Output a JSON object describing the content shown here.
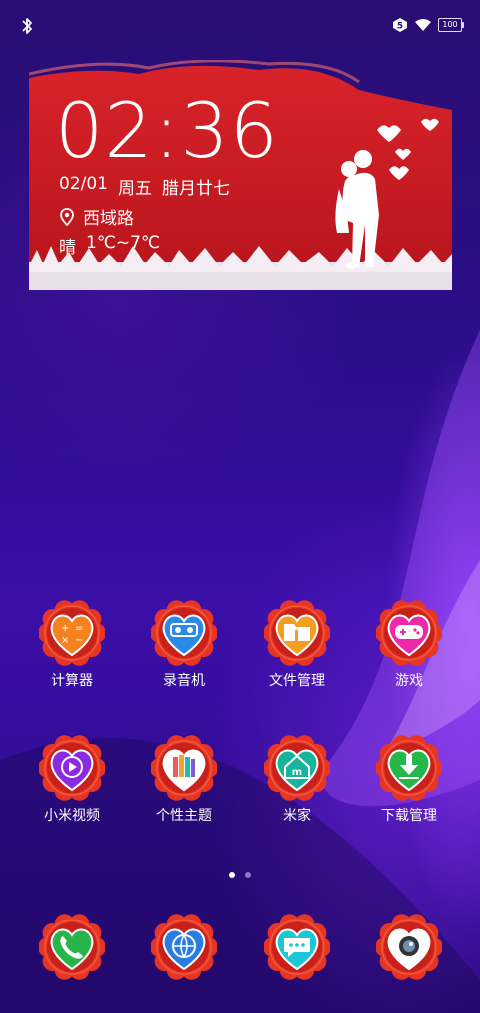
{
  "status_bar": {
    "sim_badge": "5",
    "battery": "100"
  },
  "widget": {
    "time": "02:36",
    "date": "02/01",
    "weekday": "周五",
    "lunar": "腊月廿七",
    "location": "西域路",
    "weather": "晴",
    "temperature": "1℃~7℃"
  },
  "apps": [
    {
      "label": "计算器",
      "icon": "calculator-icon",
      "color": "#f4831f"
    },
    {
      "label": "录音机",
      "icon": "recorder-icon",
      "color": "#2b8ae6"
    },
    {
      "label": "文件管理",
      "icon": "folder-icon",
      "color": "#f59d20"
    },
    {
      "label": "游戏",
      "icon": "gamepad-icon",
      "color": "#ec2aa7"
    },
    {
      "label": "小米视频",
      "icon": "video-icon",
      "color": "#8a2be2"
    },
    {
      "label": "个性主题",
      "icon": "theme-pencils-icon",
      "color": "#ffffff"
    },
    {
      "label": "米家",
      "icon": "mijia-home-icon",
      "color": "#16b49a"
    },
    {
      "label": "下载管理",
      "icon": "download-icon",
      "color": "#25b74a"
    }
  ],
  "dock": [
    {
      "icon": "phone-icon",
      "color": "#28b44a"
    },
    {
      "icon": "browser-globe-icon",
      "color": "#2a7de1"
    },
    {
      "icon": "messages-icon",
      "color": "#1cc6d4"
    },
    {
      "icon": "camera-icon",
      "color": "#ffffff"
    }
  ],
  "colors": {
    "rose": "#e63425",
    "widget_red": "#d01a22"
  },
  "page_indicator": {
    "pages": 2,
    "current": 1
  }
}
